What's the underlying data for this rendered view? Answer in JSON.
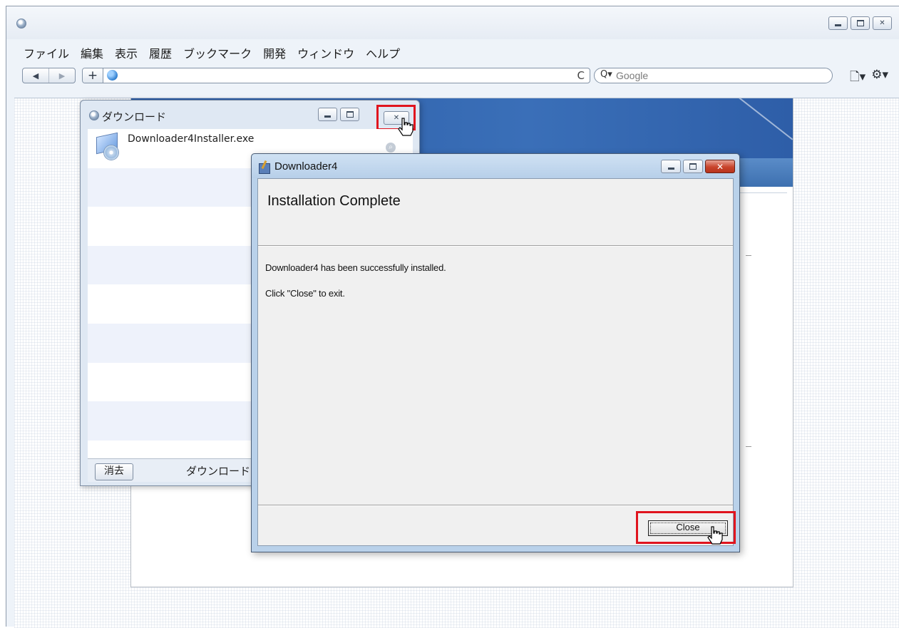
{
  "browser": {
    "menu": [
      "ファイル",
      "編集",
      "表示",
      "履歴",
      "ブックマーク",
      "開発",
      "ウィンドウ",
      "ヘルプ"
    ],
    "nav_back": "◀",
    "nav_forward": "▶",
    "address_plus": "+",
    "reload_glyph": "C",
    "search_placeholder": "Google",
    "search_glyph": "Q▾",
    "page_menu_glyph": "🗋▾",
    "settings_glyph": "⚙▾"
  },
  "downloads": {
    "title": "ダウンロード",
    "file_name": "Downloader4Installer.exe",
    "clear_label": "消去",
    "status_text": "ダウンロード"
  },
  "installer": {
    "title": "Downloader4",
    "heading": "Installation Complete",
    "message_success": "Downloader4 has been successfully installed.",
    "message_exit": "Click \"Close\" to exit.",
    "close_label": "Close"
  },
  "colors": {
    "highlight": "#e0141e",
    "site_header": "#2a5aa4",
    "titlebar": "#b9d1ea"
  }
}
